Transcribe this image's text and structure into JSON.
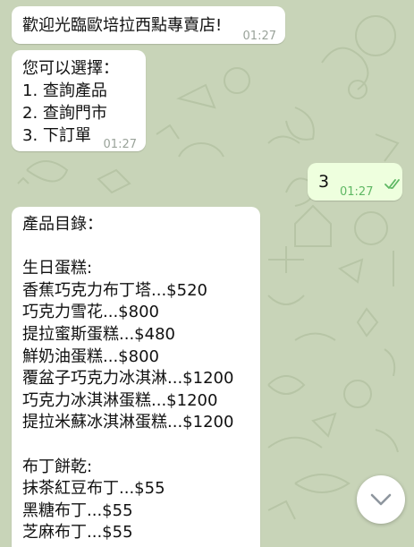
{
  "chat": {
    "messages": [
      {
        "direction": "in",
        "text": "歡迎光臨歐培拉西點專賣店!",
        "time": "01:27"
      },
      {
        "direction": "in",
        "text": "您可以選擇：\n1. 查詢產品\n2. 查詢門市\n3. 下訂單",
        "time": "01:27"
      },
      {
        "direction": "out",
        "text": "3",
        "time": "01:27",
        "status": "read"
      },
      {
        "direction": "in",
        "text": "產品目錄：\n\n生日蛋糕:\n香蕉巧克力布丁塔...$520\n巧克力雪花...$800\n提拉蜜斯蛋糕...$480\n鮮奶油蛋糕...$800\n覆盆子巧克力冰淇淋...$1200\n巧克力冰淇淋蛋糕...$1200\n提拉米蘇冰淇淋蛋糕...$1200\n\n布丁餅乾:\n抹茶紅豆布丁...$55\n黑糖布丁...$55\n芝麻布丁...$55"
      }
    ]
  },
  "scroll_button": {
    "icon": "chevron-down-icon"
  },
  "colors": {
    "wallpaper": "#c8d4b8",
    "incoming_bubble": "#ffffff",
    "outgoing_bubble": "#eeffde",
    "read_check": "#5fb864"
  }
}
